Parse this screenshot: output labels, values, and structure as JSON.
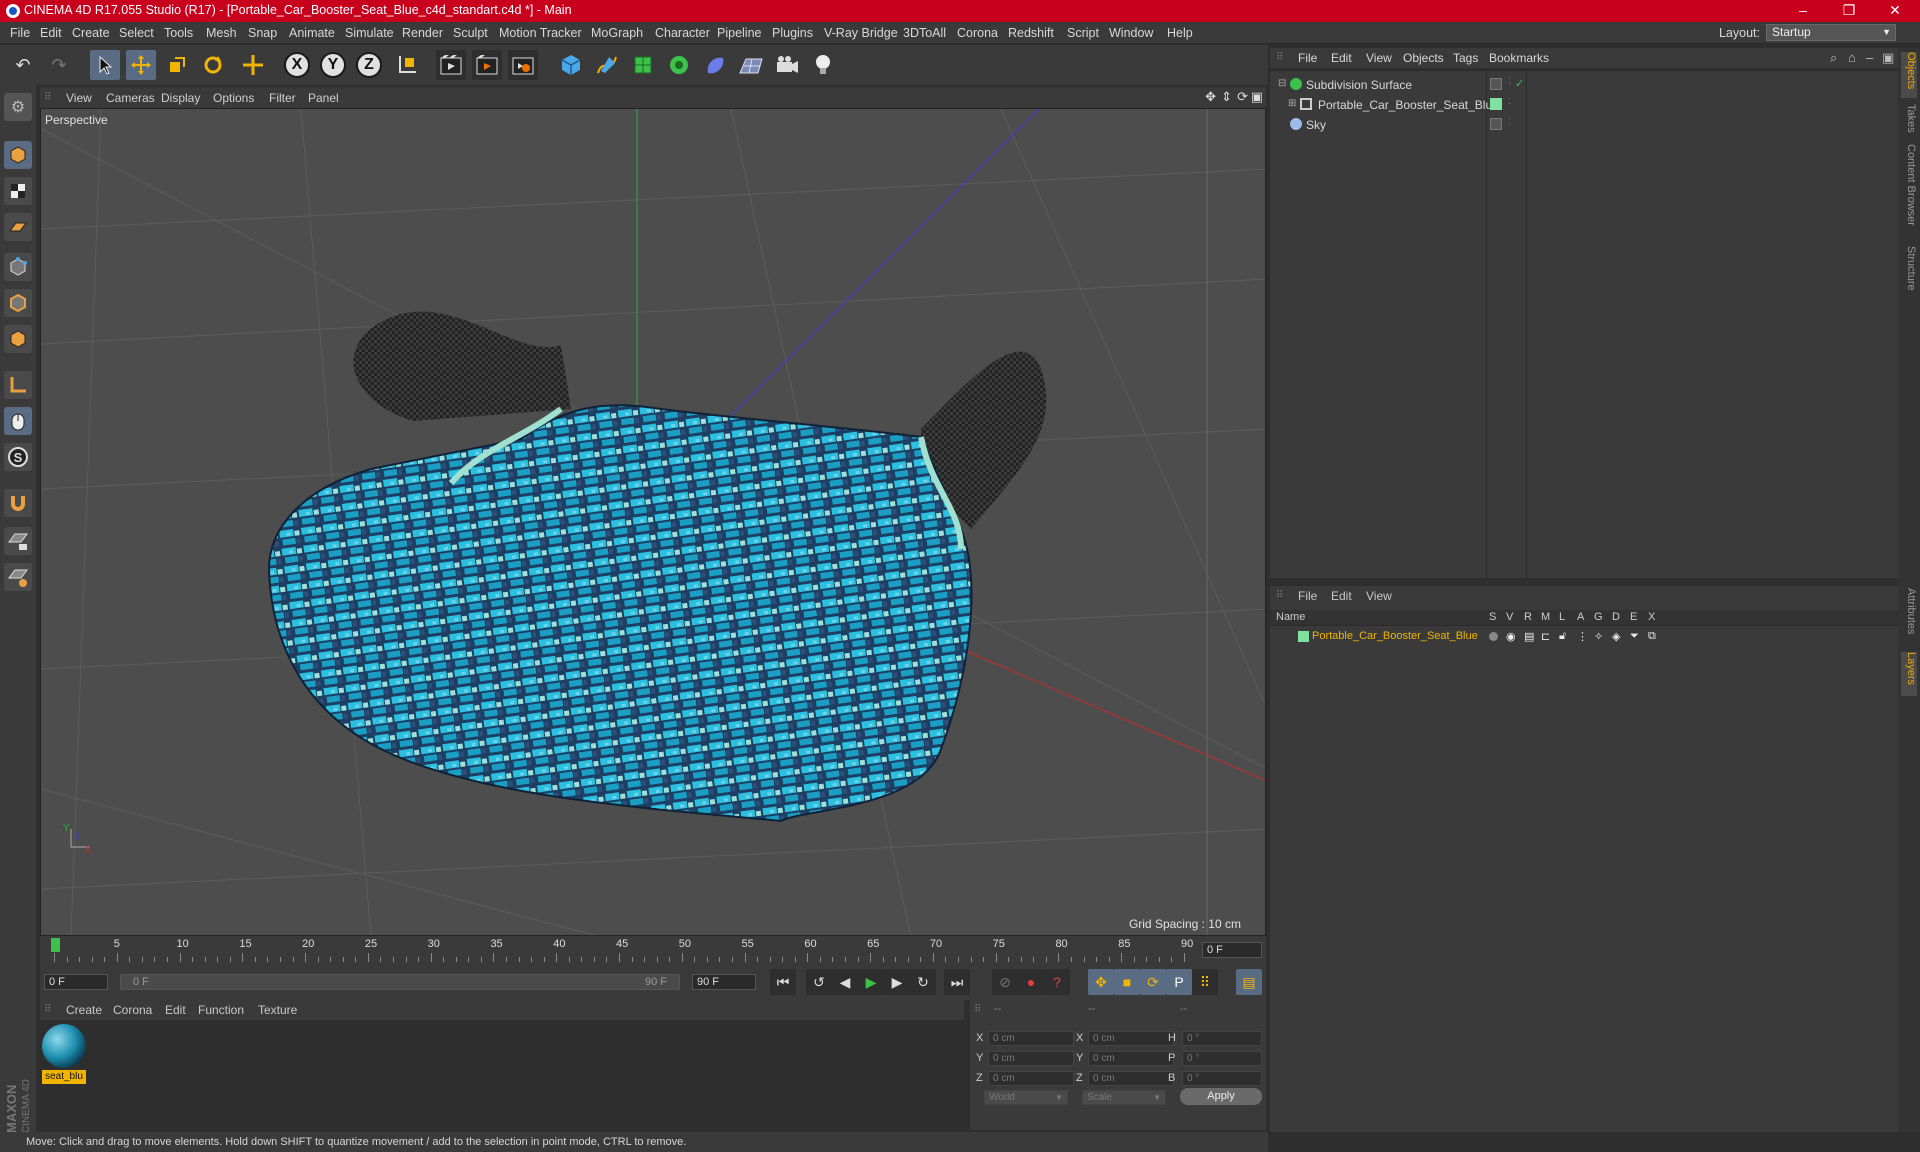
{
  "window": {
    "title": "CINEMA 4D R17.055 Studio (R17) - [Portable_Car_Booster_Seat_Blue_c4d_standart.c4d *] - Main",
    "minimize": "–",
    "restore": "❐",
    "close": "✕"
  },
  "menubar": {
    "items": [
      "File",
      "Edit",
      "Create",
      "Select",
      "Tools",
      "Mesh",
      "Snap",
      "Animate",
      "Simulate",
      "Render",
      "Sculpt",
      "Motion Tracker",
      "MoGraph",
      "Character",
      "Pipeline",
      "Plugins",
      "V-Ray Bridge",
      "3DToAll",
      "Corona",
      "Redshift",
      "Script",
      "Window",
      "Help"
    ],
    "layout_label": "Layout:",
    "layout_value": "Startup"
  },
  "toolbar": {
    "axis_x": "X",
    "axis_y": "Y",
    "axis_z": "Z"
  },
  "viewport": {
    "menu": [
      "View",
      "Cameras",
      "Display",
      "Options",
      "Filter",
      "Panel"
    ],
    "label": "Perspective",
    "grid_spacing": "Grid Spacing : 10 cm",
    "axis_y": "Y",
    "axis_x": "X",
    "axis_z": "Z"
  },
  "timeline": {
    "ticks": [
      "0",
      "5",
      "10",
      "15",
      "20",
      "25",
      "30",
      "35",
      "40",
      "45",
      "50",
      "55",
      "60",
      "65",
      "70",
      "75",
      "80",
      "85",
      "90"
    ],
    "current_frame": "0 F",
    "start_field": "0 F",
    "range_start": "0 F",
    "range_end": "90 F",
    "end_field": "90 F"
  },
  "materials": {
    "menu": [
      "Create",
      "Corona",
      "Edit",
      "Function",
      "Texture"
    ],
    "items": [
      {
        "name": "seat_blu"
      }
    ]
  },
  "coordinates": {
    "header": [
      "--",
      "--",
      "--"
    ],
    "rows": [
      {
        "l1": "X",
        "v1": "0 cm",
        "l2": "X",
        "v2": "0 cm",
        "l3": "H",
        "v3": "0 °"
      },
      {
        "l1": "Y",
        "v1": "0 cm",
        "l2": "Y",
        "v2": "0 cm",
        "l3": "P",
        "v3": "0 °"
      },
      {
        "l1": "Z",
        "v1": "0 cm",
        "l2": "Z",
        "v2": "0 cm",
        "l3": "B",
        "v3": "0 °"
      }
    ],
    "mode": "World",
    "transform": "Scale",
    "apply": "Apply"
  },
  "status": "Move: Click and drag to move elements. Hold down SHIFT to quantize movement / add to the selection in point mode, CTRL to remove.",
  "objects_panel": {
    "menu": [
      "File",
      "Edit",
      "View",
      "Objects",
      "Tags",
      "Bookmarks"
    ],
    "rows": [
      {
        "name": "Subdivision Surface"
      },
      {
        "name": "Portable_Car_Booster_Seat_Blue"
      },
      {
        "name": "Sky"
      }
    ]
  },
  "layers_panel": {
    "menu": [
      "File",
      "Edit",
      "View"
    ],
    "columns": [
      "Name",
      "S",
      "V",
      "R",
      "M",
      "L",
      "A",
      "G",
      "D",
      "E",
      "X"
    ],
    "rows": [
      {
        "name": "Portable_Car_Booster_Seat_Blue",
        "color": "#7fe0a0"
      }
    ]
  },
  "side_tabs": [
    "Objects",
    "Takes",
    "Content Browser",
    "Structure",
    "Attributes",
    "Layers"
  ],
  "branding": "MAXON CINEMA 4D",
  "colors": {
    "title_bar": "#c8001e",
    "accent_orange": "#f1b400",
    "seat_fabric": "#29b6d8",
    "seat_handles": "#1e1e1e"
  }
}
